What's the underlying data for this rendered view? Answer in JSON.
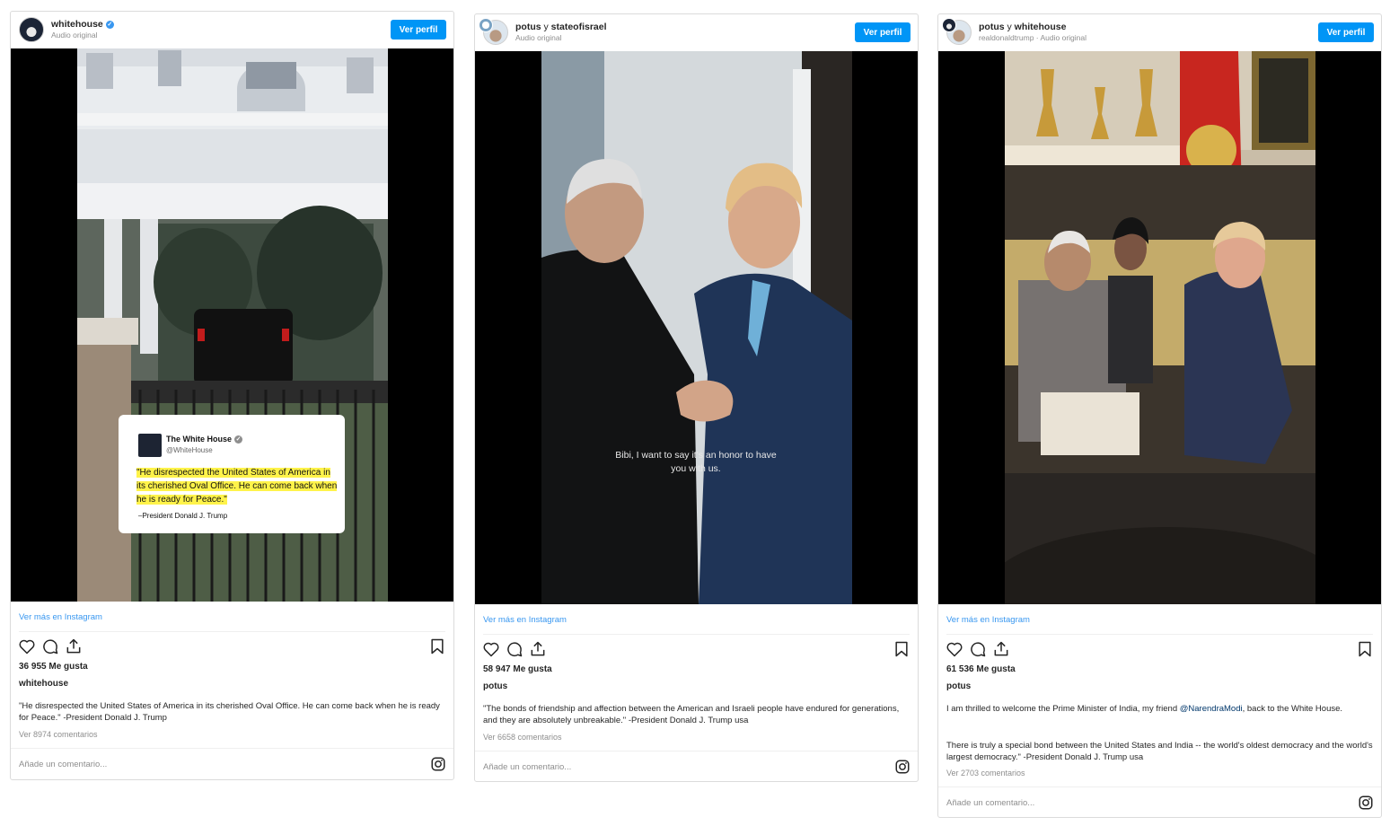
{
  "posts": [
    {
      "header": {
        "name": "whitehouse",
        "name_second": "",
        "connector": "",
        "sub": "Audio original"
      },
      "profile_button": "Ver perfil",
      "tweet_card": {
        "name": "The White House",
        "handle": "@WhiteHouse",
        "quote": "\"He disrespected the United States of America in its cherished Oval Office. He can come back when he is ready for Peace.\"",
        "attribution": "–President Donald J. Trump"
      },
      "more_link": "Ver más en Instagram",
      "likes": "36 955 Me gusta",
      "caption_user": "whitehouse",
      "caption": "\"He disrespected the United States of America in its cherished Oval Office. He can come back when he is ready for Peace.\" -President Donald J. Trump",
      "comments": "Ver 8974 comentarios",
      "add_comment": "Añade un comentario..."
    },
    {
      "header": {
        "name": "potus",
        "connector": "y",
        "name_second": "stateofisrael",
        "sub": "Audio original"
      },
      "profile_button": "Ver perfil",
      "subtitle": "Bibi, I want to say it's an honor to have you with us.",
      "more_link": "Ver más en Instagram",
      "likes": "58 947 Me gusta",
      "caption_user": "potus",
      "caption": "\"The bonds of friendship and affection between the American and Israeli people have endured for generations, and they are absolutely unbreakable.\" -President Donald J. Trump usa",
      "comments": "Ver 6658 comentarios",
      "add_comment": "Añade un comentario..."
    },
    {
      "header": {
        "name": "potus",
        "connector": "y",
        "name_second": "whitehouse",
        "sub": "realdonaldtrump · Audio original"
      },
      "profile_button": "Ver perfil",
      "more_link": "Ver más en Instagram",
      "likes": "61 536 Me gusta",
      "caption_user": "potus",
      "caption_pre": "I am thrilled to welcome the Prime Minister of India, my friend ",
      "caption_mention": "@NarendraModi",
      "caption_post": ", back to the White House.",
      "caption2": "There is truly a special bond between the United States and India -- the world's oldest democracy and the world's largest democracy.\" -President Donald J. Trump usa",
      "comments": "Ver 2703 comentarios",
      "add_comment": "Añade un comentario..."
    }
  ],
  "icons": [
    "heart-icon",
    "comment-icon",
    "share-icon",
    "bookmark-icon",
    "instagram-icon",
    "verified-icon"
  ],
  "colors": {
    "accent": "#0095f6",
    "link": "#3897f0",
    "highlight": "#fff34a"
  }
}
